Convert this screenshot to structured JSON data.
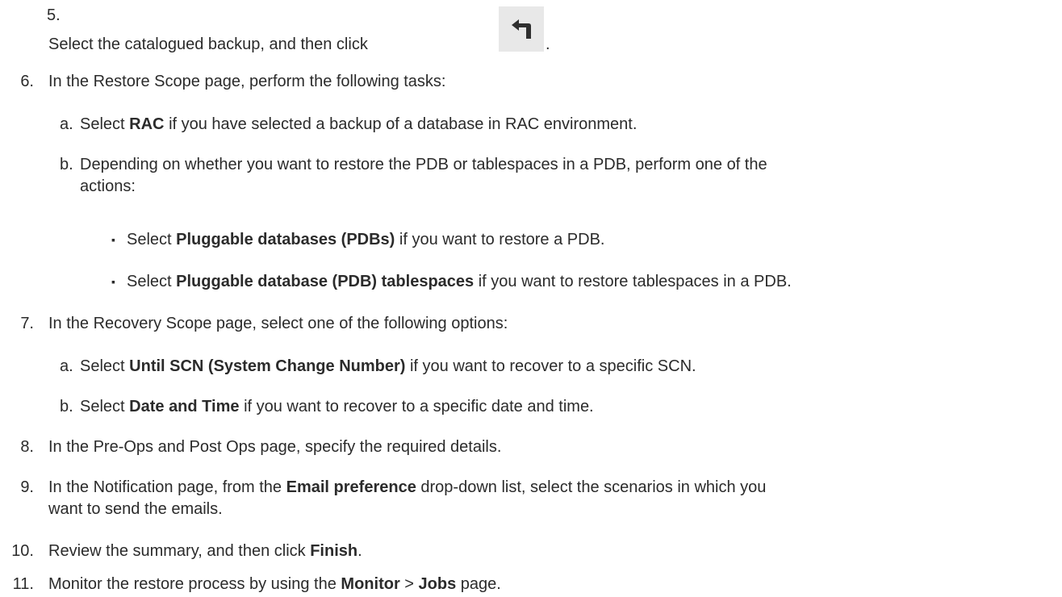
{
  "steps": {
    "s5": {
      "num": "5.",
      "text": "Select the catalogued backup, and then click",
      "trail": ".",
      "icon": "restore-icon"
    },
    "s6": {
      "num": "6.",
      "text": "In the Restore Scope page, perform the following tasks:",
      "a": {
        "letter": "a.",
        "pre": "Select",
        "bold": "RAC",
        "post": "if you have selected a backup of a database in RAC environment."
      },
      "b": {
        "letter": "b.",
        "line1": "Depending on whether you want to restore the PDB or tablespaces in a PDB, perform one of the",
        "line2": "actions:",
        "bullets": [
          {
            "pre": "Select",
            "bold": "Pluggable databases (PDBs)",
            "post": "if you want to restore a PDB."
          },
          {
            "pre": "Select",
            "bold": "Pluggable database (PDB) tablespaces",
            "post": "if you want to restore tablespaces in a PDB."
          }
        ]
      }
    },
    "s7": {
      "num": "7.",
      "text": "In the Recovery Scope page, select one of the following options:",
      "a": {
        "letter": "a.",
        "pre": "Select",
        "bold": "Until SCN (System Change Number)",
        "post": "if you want to recover to a specific SCN."
      },
      "b": {
        "letter": "b.",
        "pre": "Select",
        "bold": "Date and Time",
        "post": "if you want to recover to a specific date and time."
      }
    },
    "s8": {
      "num": "8.",
      "text": "In the Pre-Ops and Post Ops page, specify the required details."
    },
    "s9": {
      "num": "9.",
      "pre": "In the Notification page, from the",
      "bold": "Email preference",
      "post": "drop-down list, select the scenarios in which you",
      "line2": "want to send the emails."
    },
    "s10": {
      "num": "10.",
      "pre": "Review the summary, and then click",
      "bold": "Finish",
      "post": "."
    },
    "s11": {
      "num": "11.",
      "pre": "Monitor the restore process by using the",
      "bold1": "Monitor",
      "sep": ">",
      "bold2": "Jobs",
      "post": "page."
    }
  },
  "colors": {
    "text": "#2b2b2b",
    "icon_bg": "#e8e8e8",
    "icon_fg": "#2f2f2f"
  }
}
